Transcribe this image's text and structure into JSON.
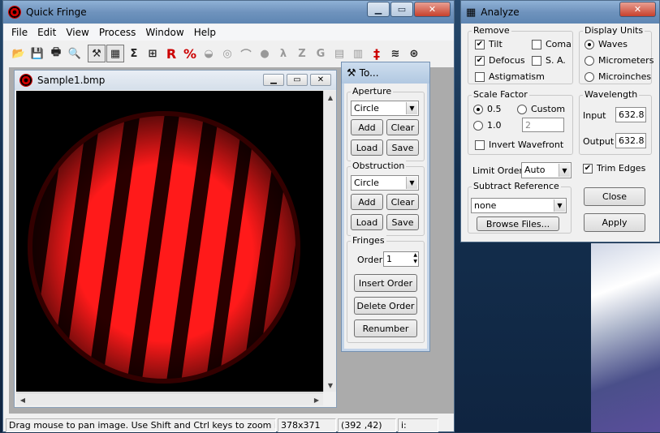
{
  "main": {
    "title": "Quick Fringe",
    "menus": [
      "File",
      "Edit",
      "View",
      "Process",
      "Window",
      "Help"
    ],
    "image_window": {
      "title": "Sample1.bmp"
    },
    "status": {
      "hint": "Drag mouse to pan image. Use Shift and Ctrl keys to zoom in and out",
      "size": "378x371",
      "coords": "(392 ,42)",
      "extra": "i:"
    }
  },
  "tools": {
    "title": "To...",
    "aperture": {
      "label": "Aperture",
      "shape": "Circle",
      "add": "Add",
      "clear": "Clear",
      "load": "Load",
      "save": "Save"
    },
    "obstruction": {
      "label": "Obstruction",
      "shape": "Circle",
      "add": "Add",
      "clear": "Clear",
      "load": "Load",
      "save": "Save"
    },
    "fringes": {
      "label": "Fringes",
      "order_label": "Order",
      "order_value": "1",
      "insert": "Insert Order",
      "delete": "Delete Order",
      "renumber": "Renumber"
    }
  },
  "analyze": {
    "title": "Analyze",
    "remove": {
      "label": "Remove",
      "tilt": "Tilt",
      "coma": "Coma",
      "defocus": "Defocus",
      "sa": "S. A.",
      "astigmatism": "Astigmatism"
    },
    "display_units": {
      "label": "Display Units",
      "waves": "Waves",
      "micrometers": "Micrometers",
      "microinches": "Microinches"
    },
    "scale_factor": {
      "label": "Scale Factor",
      "opt1": "0.5",
      "opt2": "1.0",
      "custom": "Custom",
      "custom_value": "2",
      "invert": "Invert Wavefront"
    },
    "wavelength": {
      "label": "Wavelength",
      "input_label": "Input",
      "input_value": "632.8",
      "output_label": "Output",
      "output_value": "632.8"
    },
    "limit_order": {
      "label": "Limit Order",
      "value": "Auto"
    },
    "trim_edges": "Trim Edges",
    "subtract_reference": {
      "label": "Subtract Reference",
      "value": "none",
      "browse": "Browse Files..."
    },
    "close": "Close",
    "apply": "Apply"
  },
  "colors": {
    "fringe_red": "#ff1a1a",
    "title_blue": "#6f93bd"
  }
}
